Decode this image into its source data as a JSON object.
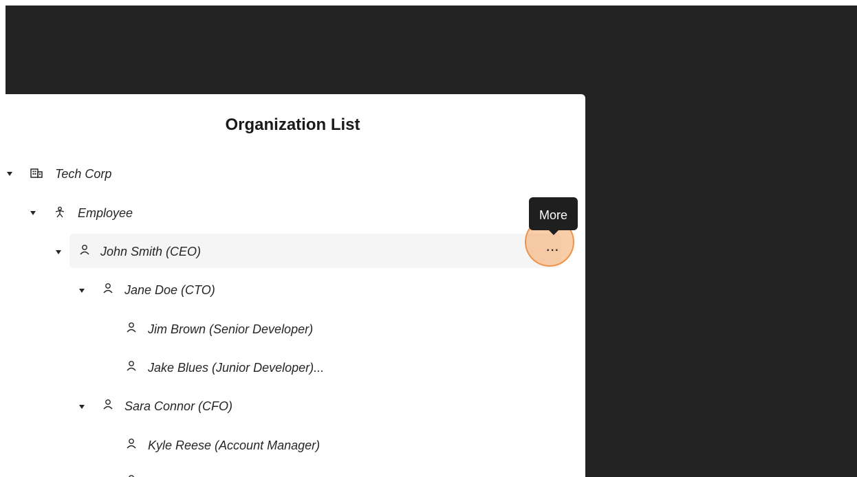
{
  "panel": {
    "title": "Organization List"
  },
  "tree": {
    "org": {
      "label": "Tech Corp",
      "icon": "building-icon"
    },
    "group": {
      "label": "Employee",
      "icon": "person-group-icon"
    },
    "ceo": {
      "label": "John Smith (CEO)",
      "icon": "user-icon"
    },
    "cto": {
      "label": "Jane Doe (CTO)",
      "icon": "user-icon"
    },
    "senior_dev": {
      "label": "Jim Brown (Senior Developer)",
      "icon": "user-icon"
    },
    "junior_dev": {
      "label": "Jake Blues (Junior Developer)...",
      "icon": "user-icon"
    },
    "cfo": {
      "label": "Sara Connor (CFO)",
      "icon": "user-icon"
    },
    "account_manager": {
      "label": "Kyle Reese (Account Manager)",
      "icon": "user-icon"
    }
  },
  "more_button": {
    "label": "···",
    "icon": "ellipsis-icon"
  },
  "tooltip": {
    "label": "More"
  },
  "colors": {
    "backdrop": "#232323",
    "panel": "#ffffff",
    "selected_row": "#f5f5f5",
    "click_highlight": "#f4a460"
  }
}
